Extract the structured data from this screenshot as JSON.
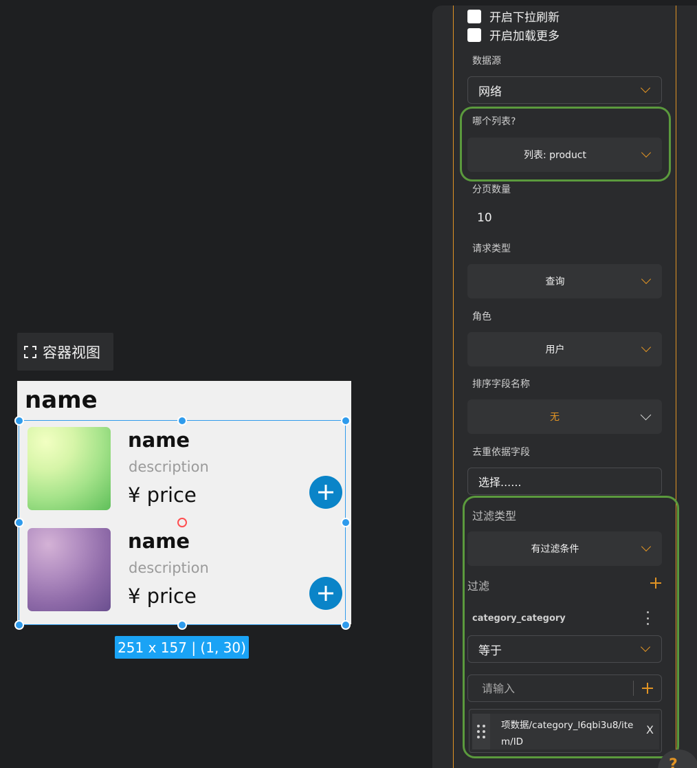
{
  "canvas": {
    "view_label": "容器视图",
    "preview_title": "name",
    "cards": [
      {
        "name": "name",
        "description": "description",
        "price": "¥ price"
      },
      {
        "name": "name",
        "description": "description",
        "price": "¥ price"
      }
    ],
    "size_badge": "251 x 157 | (1, 30)"
  },
  "panel": {
    "pull_refresh_label": "开启下拉刷新",
    "load_more_label": "开启加载更多",
    "data_source": {
      "label": "数据源",
      "value": "网络"
    },
    "which_list": {
      "label": "哪个列表?",
      "value": "列表: product"
    },
    "page_size": {
      "label": "分页数量",
      "value": "10"
    },
    "request_type": {
      "label": "请求类型",
      "value": "查询"
    },
    "role": {
      "label": "角色",
      "value": "用户"
    },
    "sort_field": {
      "label": "排序字段名称",
      "value": "无"
    },
    "dedupe_field": {
      "label": "去重依据字段",
      "value": "选择......"
    },
    "filter_type": {
      "label": "过滤类型",
      "value": "有过滤条件"
    },
    "filter": {
      "label": "过滤",
      "field_name": "category_category",
      "operator": "等于",
      "input_placeholder": "请输入",
      "tag_text": "项数据/category_l6qbi3u8/item/ID",
      "tag_remove": "X"
    },
    "help_glyph": "?"
  },
  "colors": {
    "accent": "#e29424",
    "selection": "#2f9bec",
    "highlight_frame": "#5b9a3d",
    "add_button": "#0a84c8"
  }
}
